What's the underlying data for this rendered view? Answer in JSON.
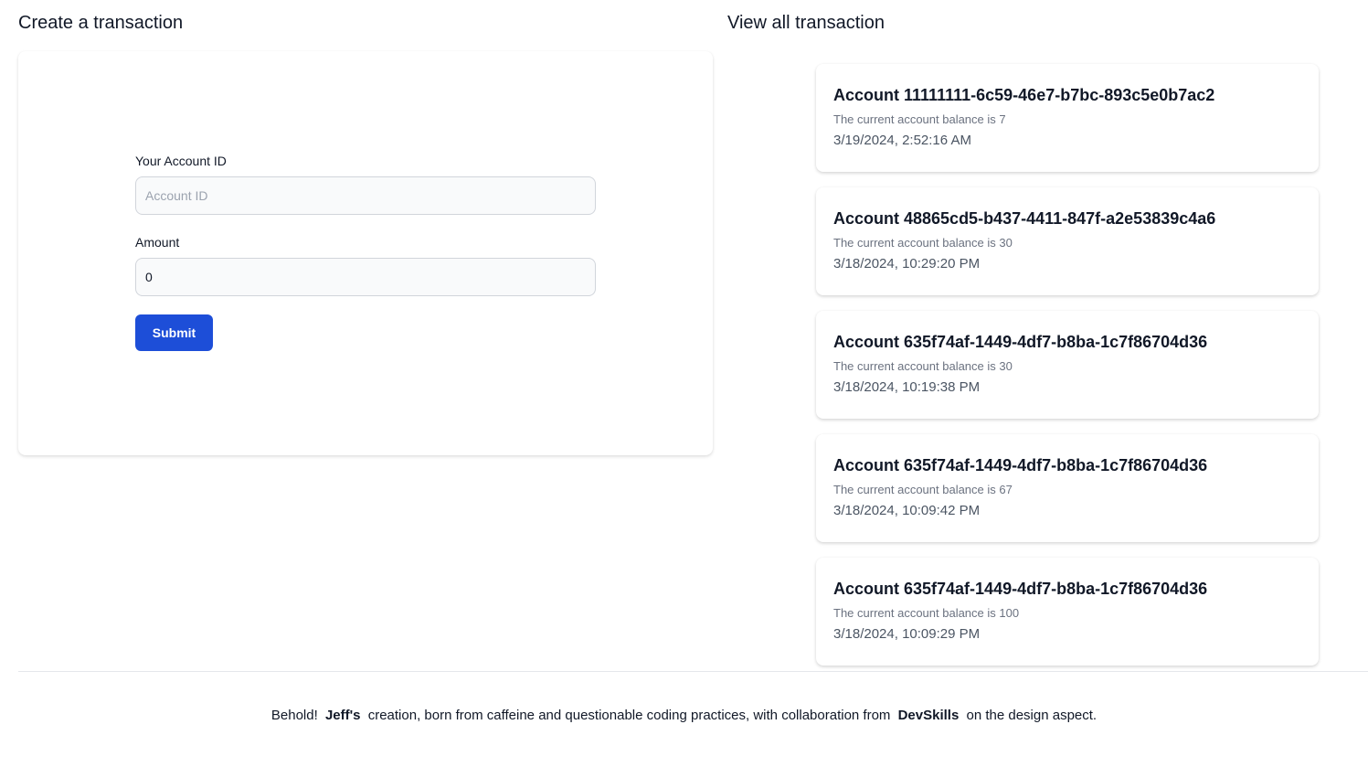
{
  "create_section": {
    "title": "Create a transaction",
    "account_field": {
      "label": "Your Account ID",
      "placeholder": "Account ID",
      "value": ""
    },
    "amount_field": {
      "label": "Amount",
      "value": "0"
    },
    "submit_label": "Submit"
  },
  "list_section": {
    "title": "View all transaction",
    "transactions": [
      {
        "title": "Account 11111111-6c59-46e7-b7bc-893c5e0b7ac2",
        "balance": "The current account balance is 7",
        "timestamp": "3/19/2024, 2:52:16 AM"
      },
      {
        "title": "Account 48865cd5-b437-4411-847f-a2e53839c4a6",
        "balance": "The current account balance is 30",
        "timestamp": "3/18/2024, 10:29:20 PM"
      },
      {
        "title": "Account 635f74af-1449-4df7-b8ba-1c7f86704d36",
        "balance": "The current account balance is 30",
        "timestamp": "3/18/2024, 10:19:38 PM"
      },
      {
        "title": "Account 635f74af-1449-4df7-b8ba-1c7f86704d36",
        "balance": "The current account balance is 67",
        "timestamp": "3/18/2024, 10:09:42 PM"
      },
      {
        "title": "Account 635f74af-1449-4df7-b8ba-1c7f86704d36",
        "balance": "The current account balance is 100",
        "timestamp": "3/18/2024, 10:09:29 PM"
      }
    ]
  },
  "footer": {
    "prefix": "Behold!",
    "author": "Jeff's",
    "middle": "creation, born from caffeine and questionable coding practices, with collaboration from",
    "collaborator": "DevSkills",
    "suffix": "on the design aspect."
  },
  "colors": {
    "accent": "#1d4ed8",
    "input_bg": "#f9fafb",
    "input_border": "#d1d5db",
    "muted_text": "#6b7280"
  }
}
